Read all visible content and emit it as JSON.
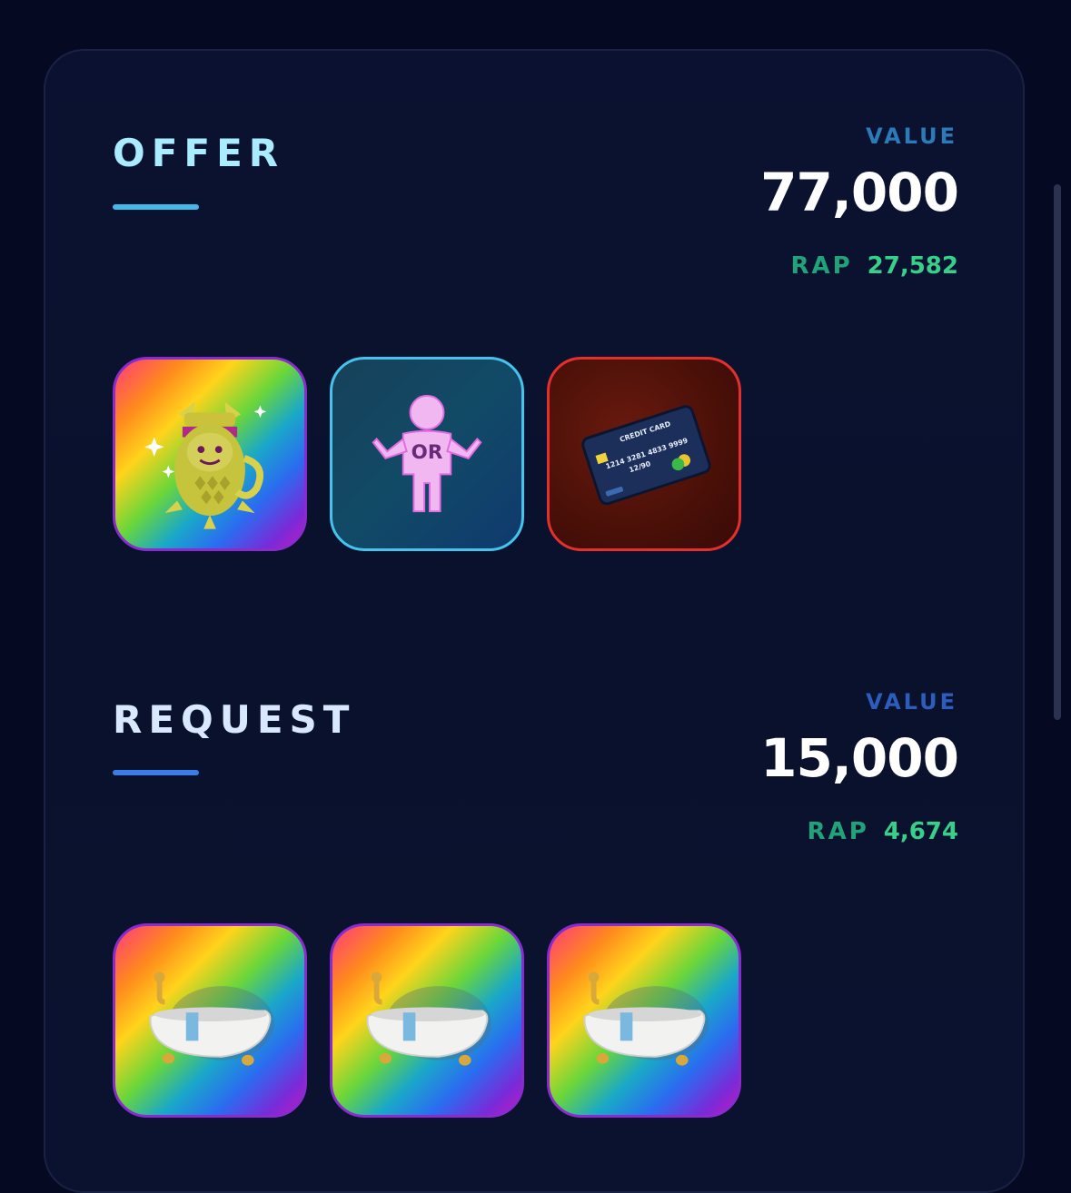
{
  "offer": {
    "title": "OFFER",
    "value_label": "VALUE",
    "value": "77,000",
    "rap_label": "RAP",
    "rap_value": "27,582",
    "items": [
      {
        "icon": "spiky-pineapple-item-icon",
        "style": "rainbow"
      },
      {
        "icon": "or-person-icon",
        "text": "OR",
        "style": "or"
      },
      {
        "icon": "credit-card-icon",
        "style": "red",
        "card": {
          "title": "CREDIT CARD",
          "number": "1214 3281 4833 9999",
          "expiry": "12/90"
        }
      }
    ]
  },
  "request": {
    "title": "REQUEST",
    "value_label": "VALUE",
    "value": "15,000",
    "rap_label": "RAP",
    "rap_value": "4,674",
    "items": [
      {
        "icon": "bathtub-icon",
        "style": "rainbow"
      },
      {
        "icon": "bathtub-icon",
        "style": "rainbow"
      },
      {
        "icon": "bathtub-icon",
        "style": "rainbow"
      }
    ]
  },
  "colors": {
    "background": "#050a22",
    "offer_accent": "#44b7e6",
    "request_accent": "#3a7ce8",
    "rap_green": "#37d08a"
  }
}
